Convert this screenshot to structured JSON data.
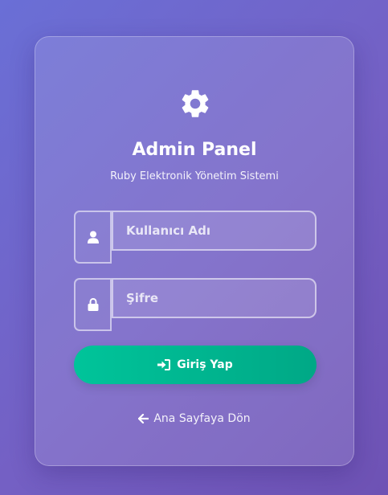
{
  "panel": {
    "title": "Admin Panel",
    "subtitle": "Ruby Elektronik Yönetim Sistemi"
  },
  "form": {
    "username_placeholder": "Kullanıcı Adı",
    "password_placeholder": "Şifre",
    "login_label": "Giriş Yap"
  },
  "footer": {
    "back_label": "Ana Sayfaya Dön"
  },
  "icons": {
    "header": "gear-icon",
    "username": "user-icon",
    "password": "lock-icon",
    "login": "sign-in-icon",
    "back": "arrow-left-icon"
  },
  "colors": {
    "accent": "#00b894"
  }
}
